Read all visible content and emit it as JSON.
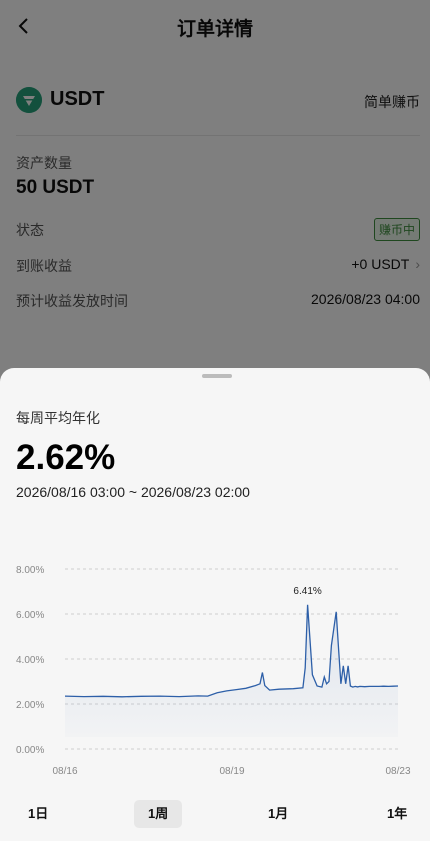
{
  "header": {
    "title": "订单详情"
  },
  "asset": {
    "coin": "USDT",
    "product_type": "简单赚币"
  },
  "amount": {
    "label": "资产数量",
    "value": "50 USDT"
  },
  "rows": {
    "status_label": "状态",
    "status_value": "赚币中",
    "earnings_label": "到账收益",
    "earnings_value": "+0 USDT",
    "payout_label": "预计收益发放时间",
    "payout_value": "2026/08/23 04:00"
  },
  "sheet": {
    "apr_label": "每周平均年化",
    "apr_value": "2.62%",
    "range": "2026/08/16 03:00 ~ 2026/08/23 02:00"
  },
  "chart_data": {
    "type": "area",
    "y_ticks": [
      "8.00%",
      "6.00%",
      "4.00%",
      "2.00%",
      "0.00%"
    ],
    "x_ticks": [
      "08/16",
      "08/19",
      "08/23"
    ],
    "ylim": [
      0,
      8
    ],
    "peak_label": "6.41%",
    "line_color": "#2d5fa8",
    "series": [
      {
        "x": [
          0,
          0.4,
          0.8,
          1.2,
          1.6,
          2.0,
          2.4,
          2.8,
          3.0,
          3.2,
          3.4,
          3.6,
          3.8,
          4.0,
          4.1,
          4.15,
          4.2,
          4.3,
          4.5,
          4.8,
          5.0,
          5.05,
          5.1,
          5.2,
          5.3,
          5.4,
          5.45,
          5.5,
          5.55,
          5.6,
          5.7,
          5.75,
          5.8,
          5.85,
          5.9,
          5.95,
          6.0,
          6.05,
          6.1,
          6.15,
          6.2,
          6.3,
          6.4,
          6.5,
          6.6,
          6.7,
          6.8,
          6.9,
          7.0
        ],
        "y": [
          2.35,
          2.33,
          2.34,
          2.32,
          2.34,
          2.35,
          2.33,
          2.36,
          2.35,
          2.5,
          2.58,
          2.64,
          2.7,
          2.82,
          2.9,
          3.4,
          2.82,
          2.62,
          2.66,
          2.68,
          2.72,
          3.6,
          6.41,
          3.3,
          2.8,
          2.75,
          3.2,
          2.9,
          3.0,
          4.6,
          6.1,
          4.5,
          2.9,
          3.7,
          2.9,
          3.7,
          2.8,
          2.75,
          2.78,
          2.76,
          2.78,
          2.77,
          2.78,
          2.78,
          2.78,
          2.79,
          2.78,
          2.79,
          2.8
        ]
      }
    ]
  },
  "tabs": [
    "1日",
    "1周",
    "1月",
    "1年"
  ],
  "active_tab": "1周"
}
